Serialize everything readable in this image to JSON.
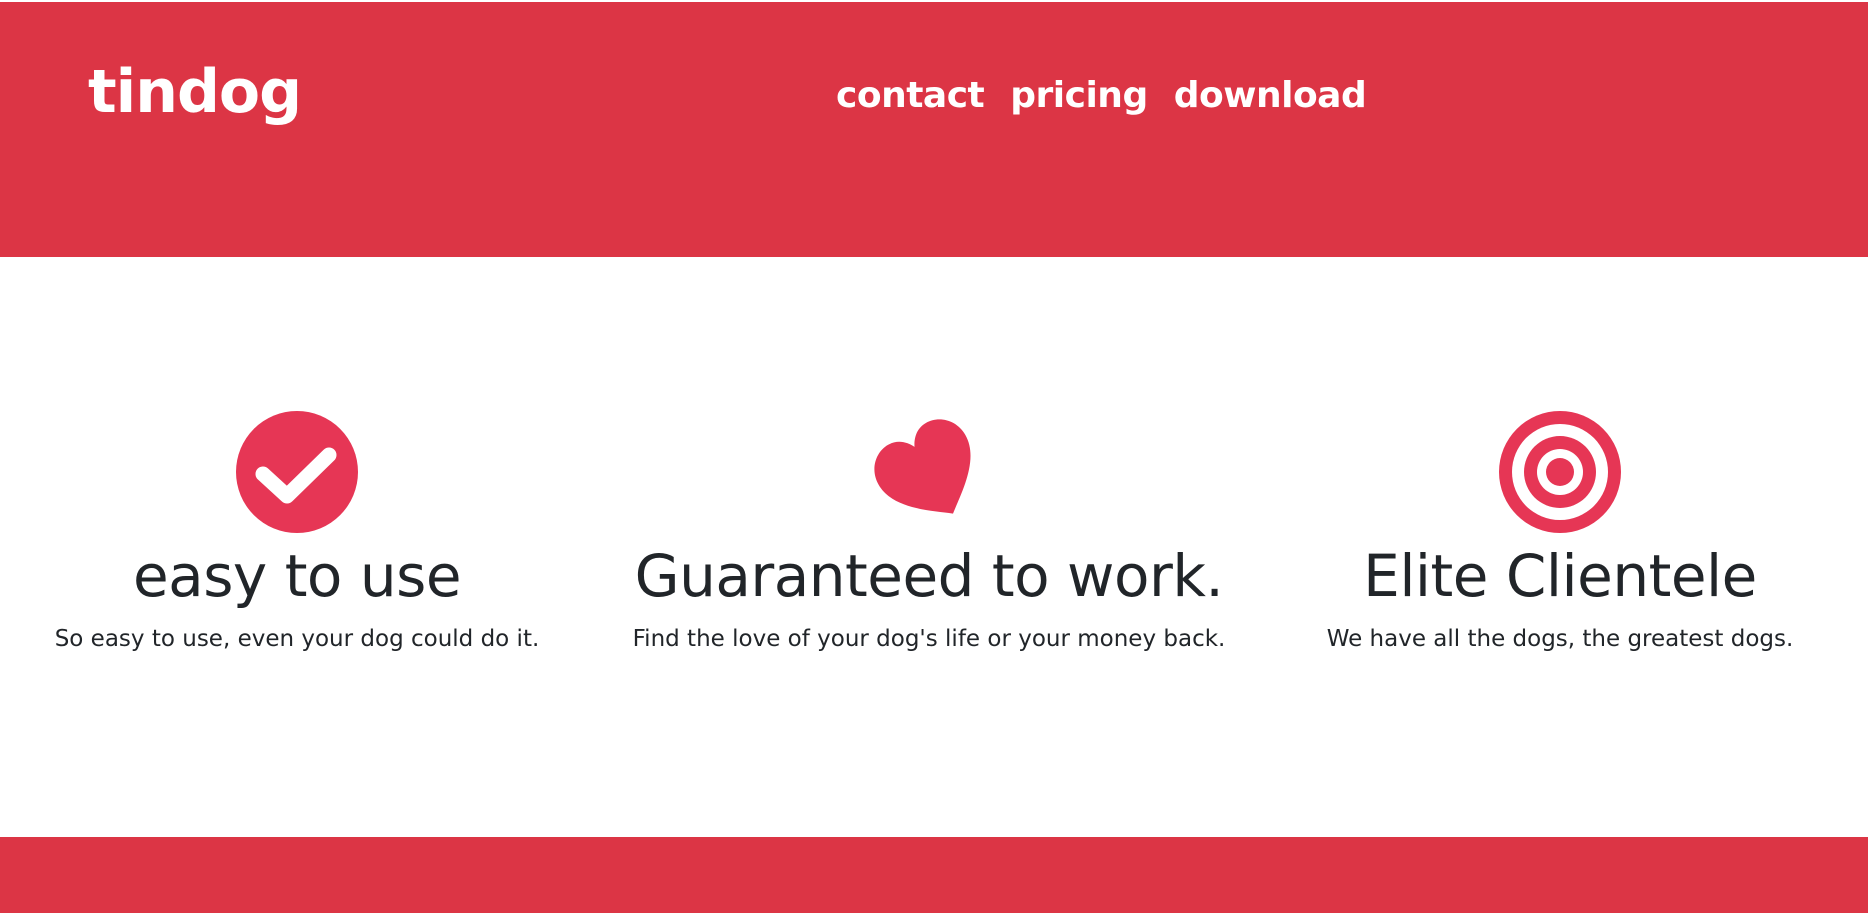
{
  "header": {
    "brand": "tindog",
    "nav": [
      {
        "label": "contact"
      },
      {
        "label": "pricing"
      },
      {
        "label": "download"
      }
    ]
  },
  "features": [
    {
      "icon": "check-circle-icon",
      "title": "easy to use",
      "text": "So easy to use, even your dog could do it."
    },
    {
      "icon": "heart-icon",
      "title": "Guaranteed to work.",
      "text": "Find the love of your dog's life or your money back."
    },
    {
      "icon": "bullseye-icon",
      "title": "Elite Clientele",
      "text": "We have all the dogs, the greatest dogs."
    }
  ],
  "colors": {
    "brand_red": "#dc3545",
    "icon_red": "#e63655",
    "text_dark": "#212529",
    "background": "#ffffff"
  }
}
